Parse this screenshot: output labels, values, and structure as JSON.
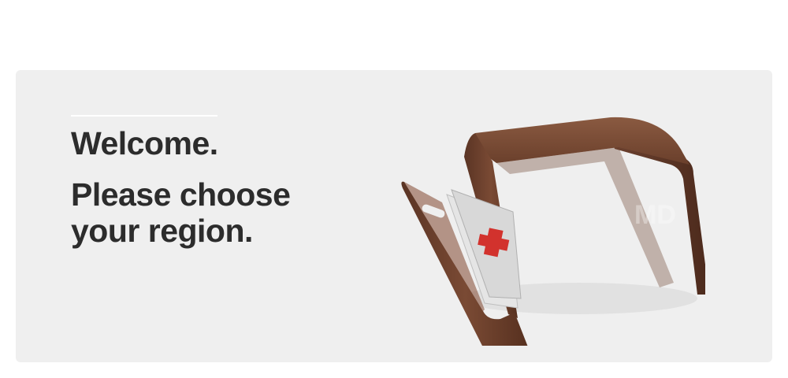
{
  "hero": {
    "welcome": "Welcome.",
    "prompt": "Please choose your region.",
    "background_color": "#efefef",
    "text_color": "#2c2c2c"
  },
  "product_image": {
    "subject": "bent plywood side table with magazine rack",
    "watermark": "MD"
  }
}
